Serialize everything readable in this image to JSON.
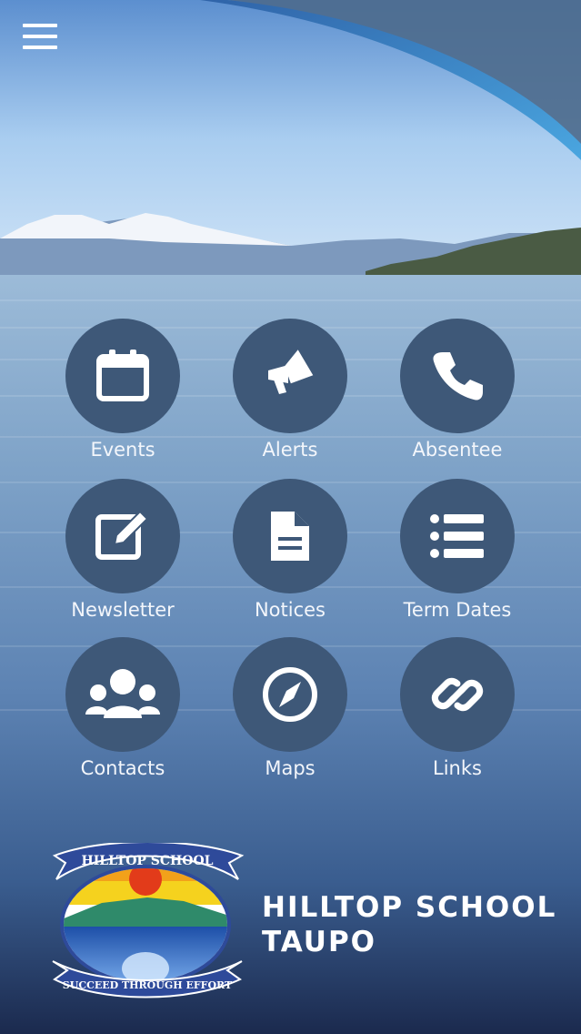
{
  "header": {
    "menu_icon": "hamburger-menu-icon"
  },
  "tiles": [
    {
      "label": "Events",
      "icon": "calendar-icon"
    },
    {
      "label": "Alerts",
      "icon": "megaphone-icon"
    },
    {
      "label": "Absentee",
      "icon": "phone-icon"
    },
    {
      "label": "Newsletter",
      "icon": "edit-icon"
    },
    {
      "label": "Notices",
      "icon": "document-icon"
    },
    {
      "label": "Term Dates",
      "icon": "list-icon"
    },
    {
      "label": "Contacts",
      "icon": "users-icon"
    },
    {
      "label": "Maps",
      "icon": "compass-icon"
    },
    {
      "label": "Links",
      "icon": "link-icon"
    }
  ],
  "school": {
    "name_line1": "HILLTOP SCHOOL",
    "name_line2": "TAUPO",
    "logo_top_text": "HILLTOP SCHOOL",
    "logo_motto": "SUCCEED THROUGH EFFORT"
  },
  "colors": {
    "tile_circle": "#3e5878",
    "background_bottom": "#1b2a4e",
    "accent_arc": "#4aa6e0"
  }
}
